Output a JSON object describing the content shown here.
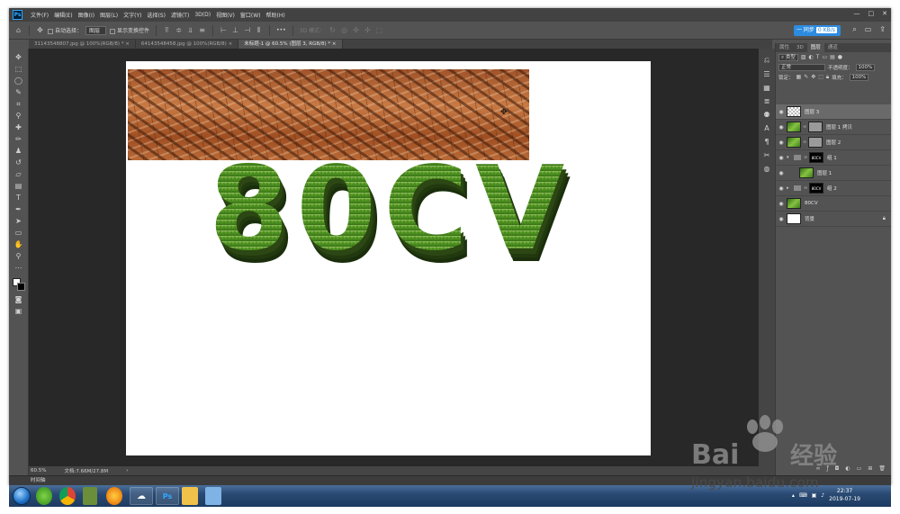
{
  "app": {
    "logo": "Ps",
    "window_controls": [
      "—",
      "□",
      "✕"
    ]
  },
  "menu": [
    "文件(F)",
    "编辑(E)",
    "图像(I)",
    "图层(L)",
    "文字(Y)",
    "选择(S)",
    "滤镜(T)",
    "3D(D)",
    "视图(V)",
    "窗口(W)",
    "帮助(H)"
  ],
  "options": {
    "auto_select_label": "自动选择：",
    "layer_dropdown": "图层",
    "transform_label": "显示变换控件",
    "mode_3d": "3D 模式：",
    "more": "•••"
  },
  "cloud_badge": {
    "label": "一 同步",
    "speed": "0 KB/s"
  },
  "tabs": [
    {
      "label": "31143548807.jpg @ 100%(RGB/8) *",
      "close": "×"
    },
    {
      "label": "64143548458.jpg @ 100%(RGB/8)",
      "close": "×"
    },
    {
      "label": "未标题-1 @ 60.5% (图层 3, RGB/8) *",
      "close": "×"
    }
  ],
  "canvas": {
    "art_text": "80CV"
  },
  "status": {
    "zoom": "60.5%",
    "doc": "文档:7.66M/27.8M",
    "arrow": "›"
  },
  "timeline": {
    "label": "时间轴"
  },
  "panel": {
    "tabs": [
      "属性",
      "3D",
      "图层",
      "通道"
    ],
    "filter_label": "类型",
    "blend_mode": "正常",
    "opacity_label": "不透明度：",
    "opacity_value": "100%",
    "lock_label": "锁定：",
    "fill_label": "填充：",
    "fill_value": "100%",
    "layers": [
      {
        "name": "图层 3",
        "selected": true
      },
      {
        "name": "图层 1 拷贝"
      },
      {
        "name": "图层 2"
      },
      {
        "name": "组 1"
      },
      {
        "name": "图层 1"
      },
      {
        "name": "组 2"
      },
      {
        "name": "80CV"
      },
      {
        "name": "背景"
      }
    ]
  },
  "taskbar": {
    "time": "22:37",
    "date": "2019-07-19"
  },
  "watermark": {
    "text": "jingyan.baidu.com",
    "brand_a": "Bai",
    "brand_b": "经验"
  }
}
